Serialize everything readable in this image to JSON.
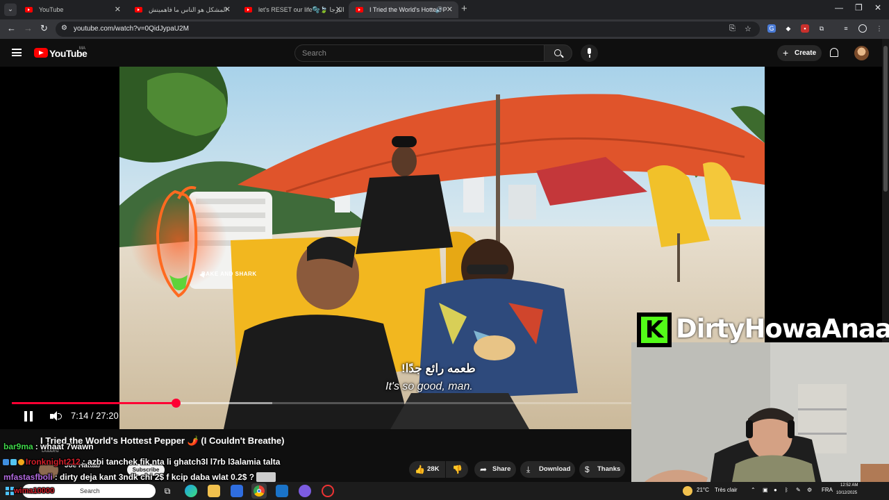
{
  "browser": {
    "tabs": [
      {
        "title": "YouTube",
        "active": false
      },
      {
        "title": "المشكل هو الناس ما فاهمينش",
        "active": false
      },
      {
        "title": "let's RESET our life🫧🍃 البرجا",
        "active": false
      },
      {
        "title": "I Tried the World's Hottest P",
        "active": true
      }
    ],
    "url": "youtube.com/watch?v=0QidJypaU2M"
  },
  "yt": {
    "logo_text": "YouTube",
    "country": "MA",
    "search_placeholder": "Search",
    "create_label": "Create"
  },
  "video": {
    "location_tag": "BAKE AND SHARK",
    "subtitle_ar": "طعمه رائع جدًا!",
    "subtitle_en": "It's so good, man.",
    "current_time": "7:14",
    "duration": "27:20",
    "time_display": "7:14 / 27:20",
    "progress_played": 0.2646,
    "progress_buffered": 0.4205,
    "title": "I Tried the World's Hottest Pepper 🌶️ (I Couldn't Breathe)",
    "channel": "Joe Hattab",
    "dubbed_label": "Dubbed",
    "subscribe_label": "Subscribe",
    "likes": "28K",
    "share_label": "Share",
    "download_label": "Download",
    "thanks_label": "Thanks"
  },
  "chat": [
    {
      "user": "bar9ma",
      "color": "#3fd64a",
      "message": "whaat 7wawn"
    },
    {
      "user": "Ironknight212",
      "color": "#d11f2a",
      "message": "azbi tanchek fik nta li ghatch3l l7rb l3alamia talta"
    },
    {
      "user": "mfastasfboli",
      "color": "#b36be0",
      "message": "dirty deja kant 3ndk chi 2$ f kcip daba wlat 0.2$ ?"
    },
    {
      "user": "wima10000",
      "color": "#d11f2a",
      "message": ""
    }
  ],
  "stream": {
    "streamer_name": "DirtyHowaAnaa",
    "platform_letter": "K",
    "platform_color": "#53fc18"
  },
  "taskbar": {
    "search_text": "Search",
    "weather": "21°C",
    "weather_desc": "Très clair",
    "lang": "FRA",
    "time": "12:52 AM",
    "date": "10/12/2025"
  }
}
